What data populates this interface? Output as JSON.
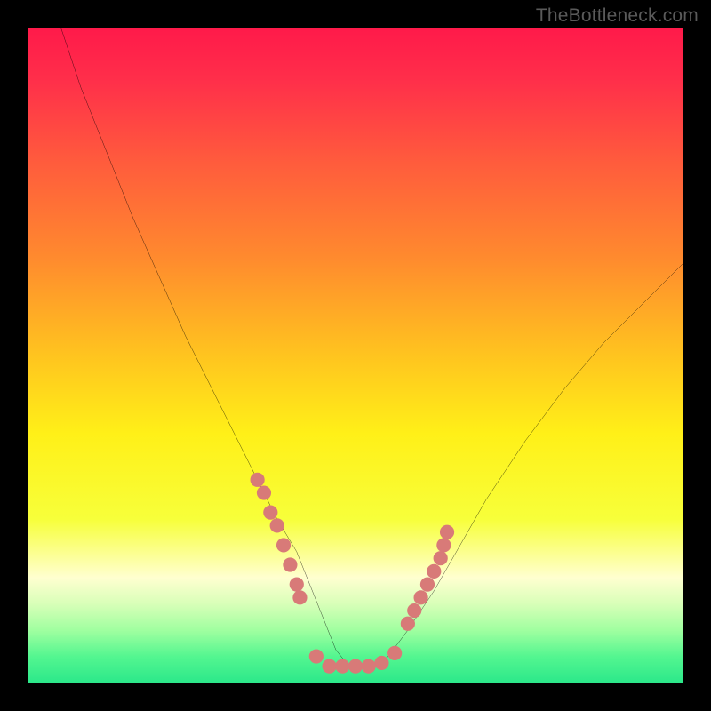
{
  "watermark": "TheBottleneck.com",
  "gradient_stops": [
    {
      "offset": 0.0,
      "color": "#ff1a4a"
    },
    {
      "offset": 0.08,
      "color": "#ff2f4a"
    },
    {
      "offset": 0.2,
      "color": "#ff5a3d"
    },
    {
      "offset": 0.35,
      "color": "#ff8a2e"
    },
    {
      "offset": 0.5,
      "color": "#ffc41f"
    },
    {
      "offset": 0.62,
      "color": "#fff018"
    },
    {
      "offset": 0.75,
      "color": "#f7ff3a"
    },
    {
      "offset": 0.84,
      "color": "#ffffd0"
    },
    {
      "offset": 0.88,
      "color": "#d8ffb8"
    },
    {
      "offset": 0.92,
      "color": "#a0ffa0"
    },
    {
      "offset": 0.96,
      "color": "#54f690"
    },
    {
      "offset": 1.0,
      "color": "#2ce88a"
    }
  ],
  "chart_data": {
    "type": "line",
    "title": "",
    "xlabel": "",
    "ylabel": "",
    "xlim": [
      0,
      100
    ],
    "ylim": [
      0,
      100
    ],
    "series": [
      {
        "name": "bottleneck-curve",
        "x": [
          5,
          8,
          12,
          16,
          20,
          24,
          28,
          32,
          35,
          38,
          41,
          43,
          45,
          47,
          49,
          51,
          53,
          55,
          58,
          62,
          66,
          70,
          76,
          82,
          88,
          94,
          100
        ],
        "y": [
          100,
          91,
          81,
          71,
          62,
          53,
          45,
          37,
          31,
          25,
          20,
          15,
          10,
          5,
          2.5,
          2.5,
          2.5,
          4,
          8,
          14,
          21,
          28,
          37,
          45,
          52,
          58,
          64
        ]
      }
    ],
    "markers": [
      {
        "name": "left-cluster",
        "color": "#d87a78",
        "points": [
          [
            35,
            31
          ],
          [
            36,
            29
          ],
          [
            37,
            26
          ],
          [
            38,
            24
          ],
          [
            39,
            21
          ],
          [
            40,
            18
          ],
          [
            41,
            15
          ],
          [
            41.5,
            13
          ]
        ]
      },
      {
        "name": "valley-cluster",
        "color": "#d87a78",
        "points": [
          [
            44,
            4
          ],
          [
            46,
            2.5
          ],
          [
            48,
            2.5
          ],
          [
            50,
            2.5
          ],
          [
            52,
            2.5
          ],
          [
            54,
            3
          ],
          [
            56,
            4.5
          ]
        ]
      },
      {
        "name": "right-cluster",
        "color": "#d87a78",
        "points": [
          [
            58,
            9
          ],
          [
            59,
            11
          ],
          [
            60,
            13
          ],
          [
            61,
            15
          ],
          [
            62,
            17
          ],
          [
            63,
            19
          ],
          [
            63.5,
            21
          ],
          [
            64,
            23
          ]
        ]
      }
    ]
  }
}
